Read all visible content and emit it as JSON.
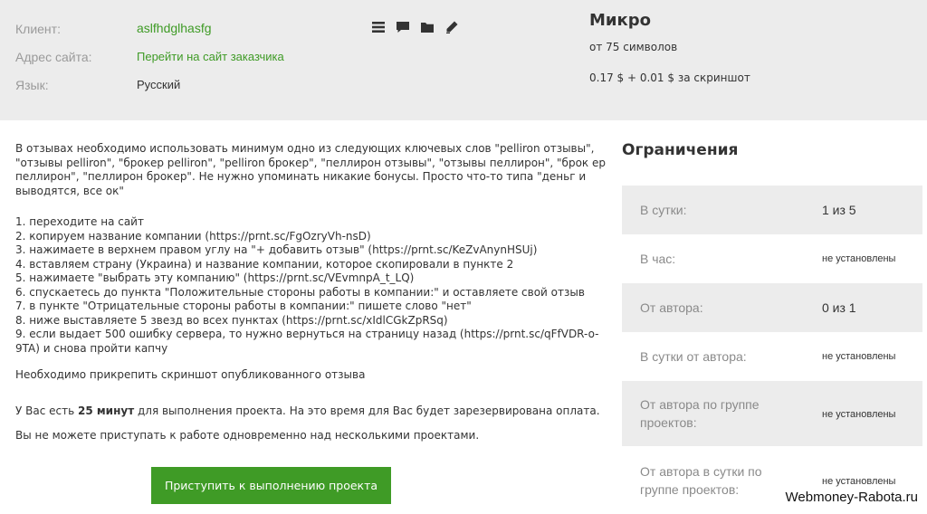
{
  "header": {
    "client_label": "Клиент:",
    "client_value": "aslfhdglhasfg",
    "site_label": "Адрес сайта:",
    "site_link": "Перейти на сайт заказчика",
    "lang_label": "Язык:",
    "lang_value": "Русский",
    "icons": [
      "list-icon",
      "comment-icon",
      "folder-icon",
      "pencil-icon"
    ]
  },
  "plan": {
    "title": "Микро",
    "min_chars": "от 75 символов",
    "price": "0.17 $ + 0.01 $ за скриншот"
  },
  "task": {
    "intro": "В отзывах необходимо использовать минимум одно из следующих ключевых слов \"pelliron отзывы\", \"отзывы pelliron\", \"брокер pelliron\", \"pelliron брокер\", \"пеллирон отзывы\", \"отзывы пеллирон\", \"брок ер пеллирон\", \"пеллирон брокер\". Не нужно упоминать никакие бонусы. Просто что-то типа \"деньг и выводятся, все ок\"",
    "steps": [
      "1. переходите на сайт",
      "2. копируем название компании (https://prnt.sc/FgOzryVh-nsD)",
      "3. нажимаете в верхнем правом углу на \"+ добавить отзыв\" (https://prnt.sc/KeZvAnynHSUj)",
      "4. вставляем страну (Украина) и название компании, которое скопировали в пункте 2",
      "5. нажимаете \"выбрать эту компанию\" (https://prnt.sc/VEvmnpA_t_LQ)",
      "6. спускаетесь до пункта \"Положительные стороны работы в компании:\" и оставляете свой отзыв",
      "7. в пункте \"Отрицательные стороны работы в компании:\" пишете слово \"нет\"",
      "8. ниже выставляете 5 звезд во всех пунктах (https://prnt.sc/xIdlCGkZpRSq)",
      "9. если выдает 500 ошибку сервера, то нужно вернуться на страницу назад (https://prnt.sc/qFfVDR-o-9TA) и снова пройти капчу"
    ],
    "screenshot_note": "Необходимо прикрепить скриншот опубликованного отзыва",
    "time_prefix": "У Вас есть ",
    "time_value": "25 минут",
    "time_suffix": " для выполнения проекта. На это время для Вас будет зарезервирована оплата.",
    "concurrent_note": "Вы не можете приступать к работе одновременно над несколькими проектами.",
    "start_button": "Приступить к выполнению проекта"
  },
  "limits": {
    "title": "Ограничения",
    "rows": [
      {
        "label": "В сутки:",
        "value": "1 из 5"
      },
      {
        "label": "В час:",
        "value": "не установлены"
      },
      {
        "label": "От автора:",
        "value": "0 из 1"
      },
      {
        "label": "В сутки от автора:",
        "value": "не установлены"
      },
      {
        "label": "От автора по группе проектов:",
        "value": "не установлены"
      },
      {
        "label": "От автора в сутки по группе проектов:",
        "value": "не установлены"
      }
    ]
  },
  "watermark": "Webmoney-Rabota.ru",
  "colors": {
    "accent": "#3f9b26",
    "header_bg": "#ececec",
    "text": "#333333",
    "muted": "#9a9a9a"
  }
}
